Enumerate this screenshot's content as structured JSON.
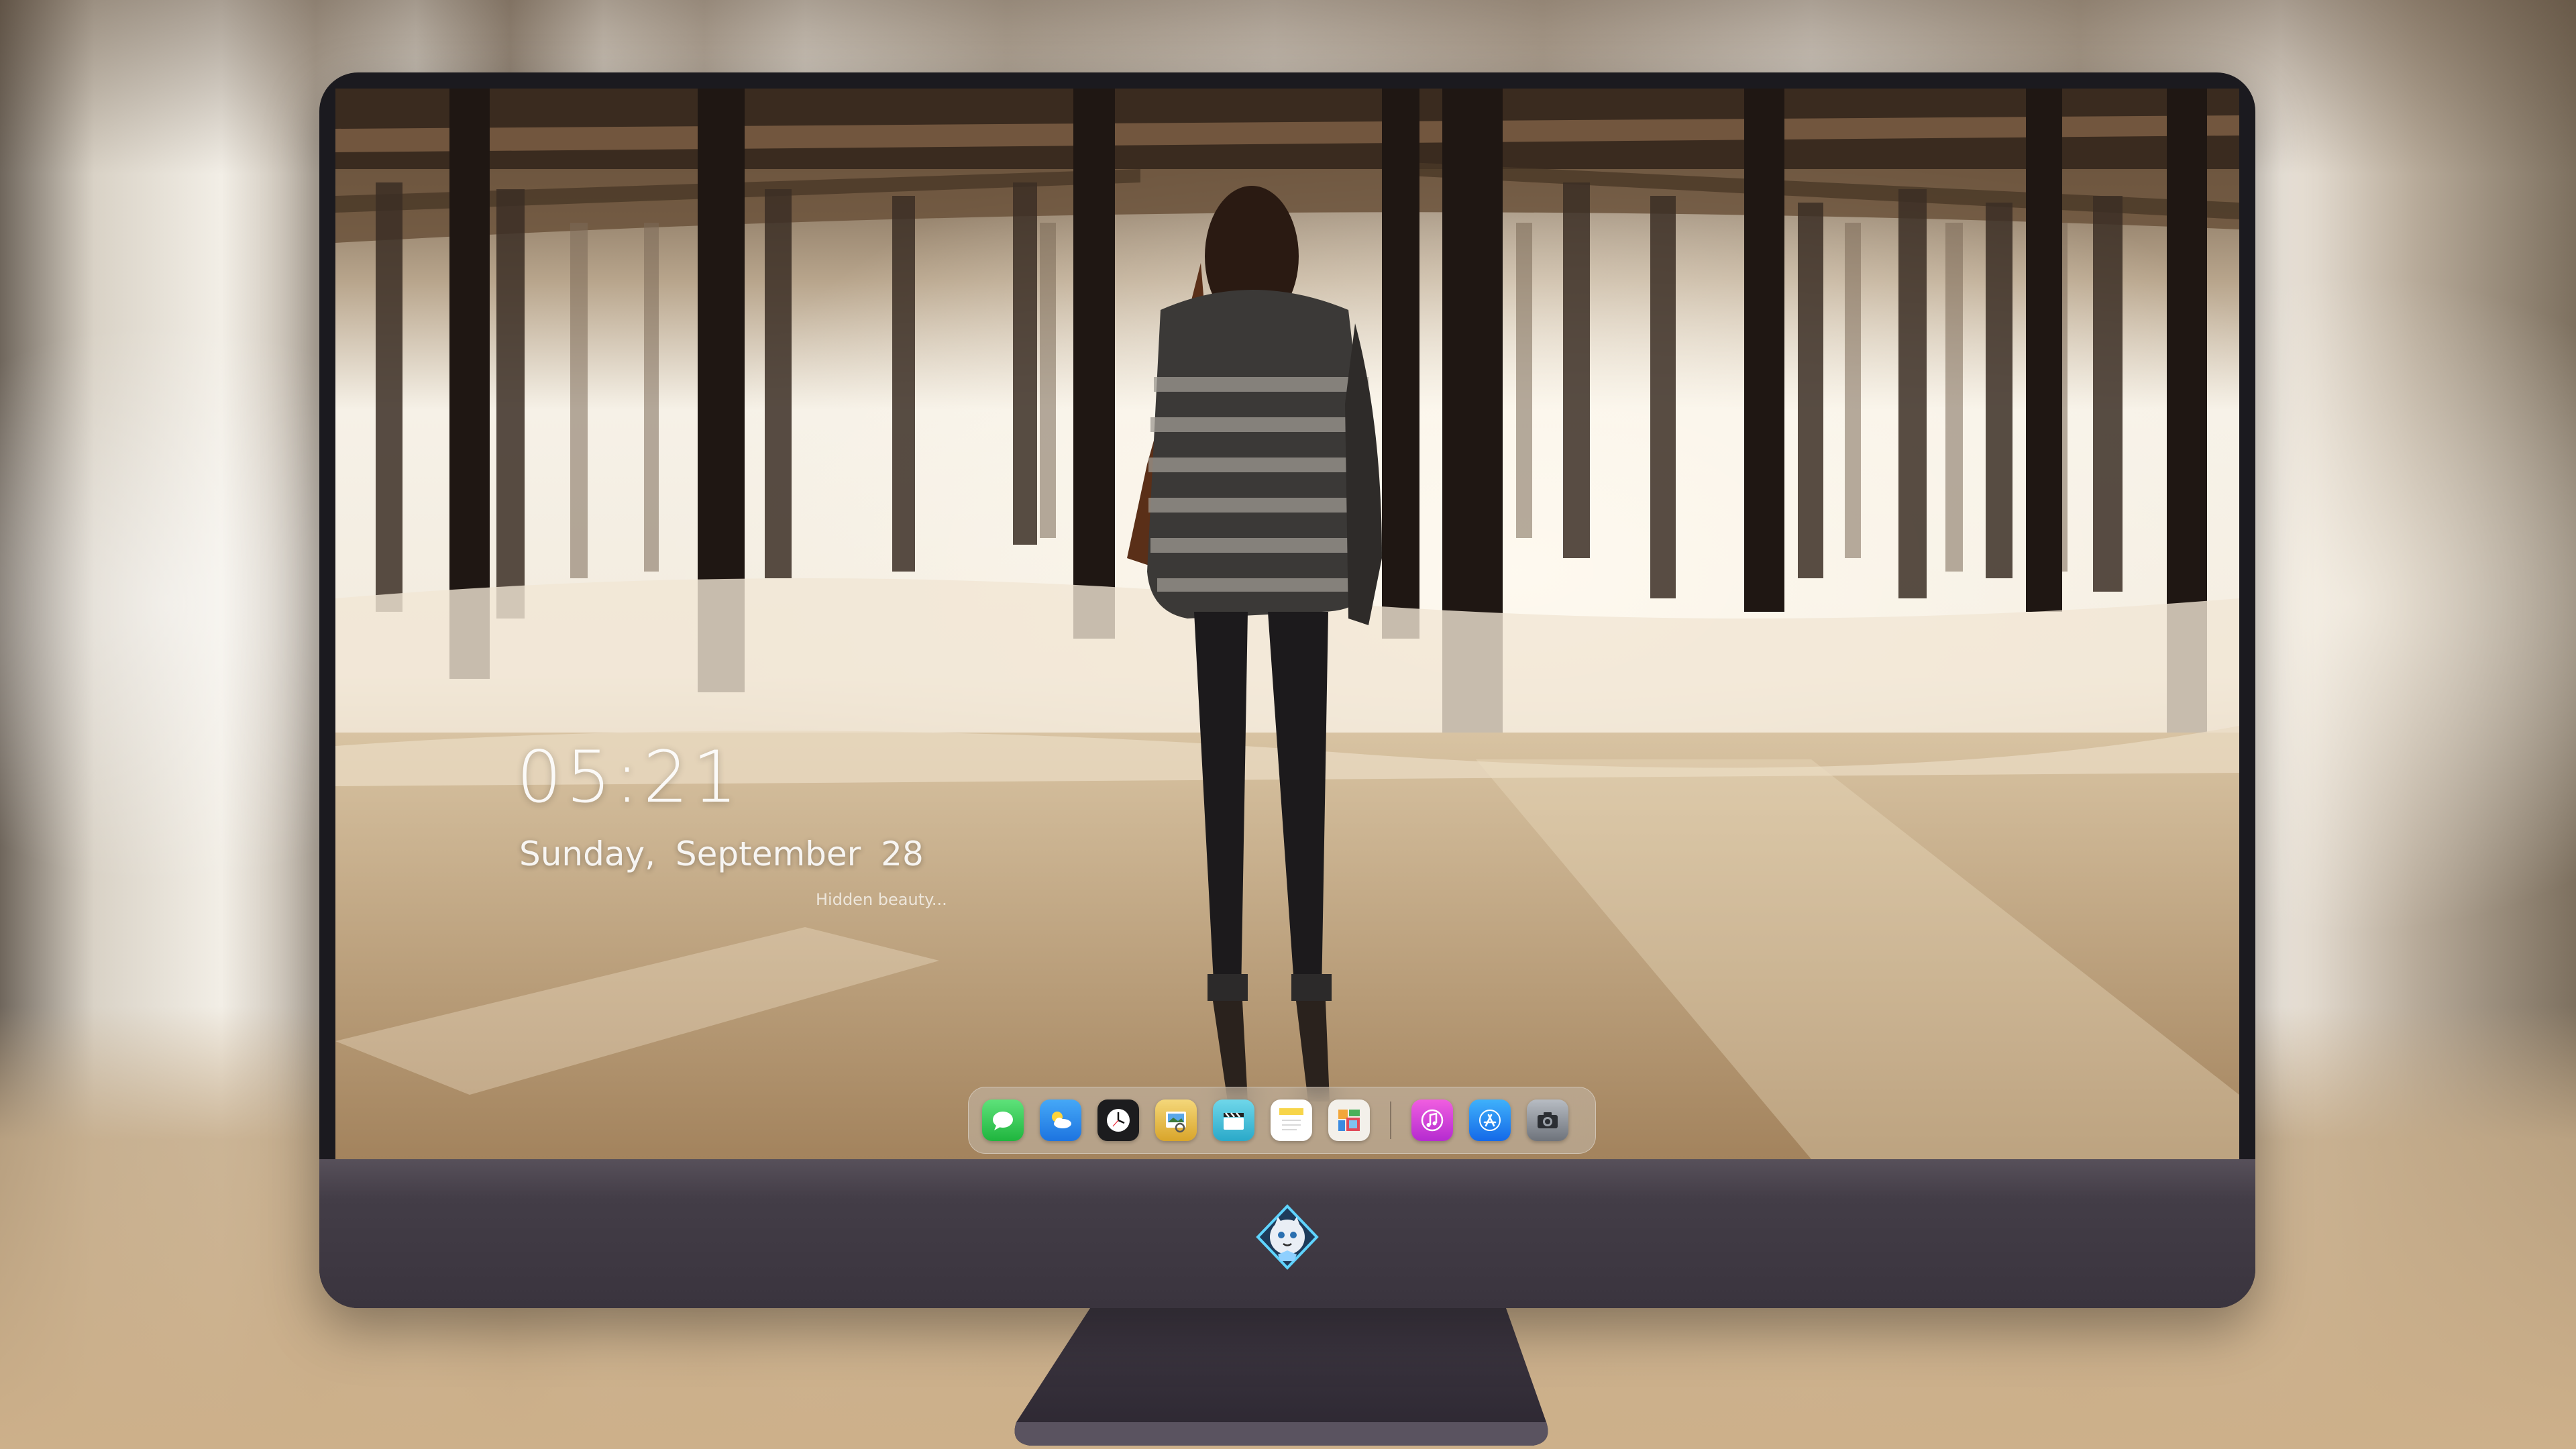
{
  "lock_screen": {
    "time": "05:21",
    "date": "Sunday, September 28",
    "quote": "Hidden beauty..."
  },
  "dock": {
    "apps": [
      {
        "icon": "messages-icon",
        "color": "#2fcb4e"
      },
      {
        "icon": "weather-icon",
        "color": "#2f8cf0"
      },
      {
        "icon": "clock-icon",
        "color": "#1c1c1e"
      },
      {
        "icon": "preview-icon",
        "color": "#e8b53a"
      },
      {
        "icon": "clapper-icon",
        "color": "#3dbcd8"
      },
      {
        "icon": "notes-icon",
        "color": "#f7d54a"
      },
      {
        "icon": "photos-collage-icon",
        "color": "#f3f0ea"
      }
    ],
    "recent_apps": [
      {
        "icon": "music-icon",
        "color": "#d93fd5"
      },
      {
        "icon": "app-store-icon",
        "color": "#1f8ef5"
      },
      {
        "icon": "camera-icon",
        "color": "#8a8f97"
      }
    ]
  }
}
